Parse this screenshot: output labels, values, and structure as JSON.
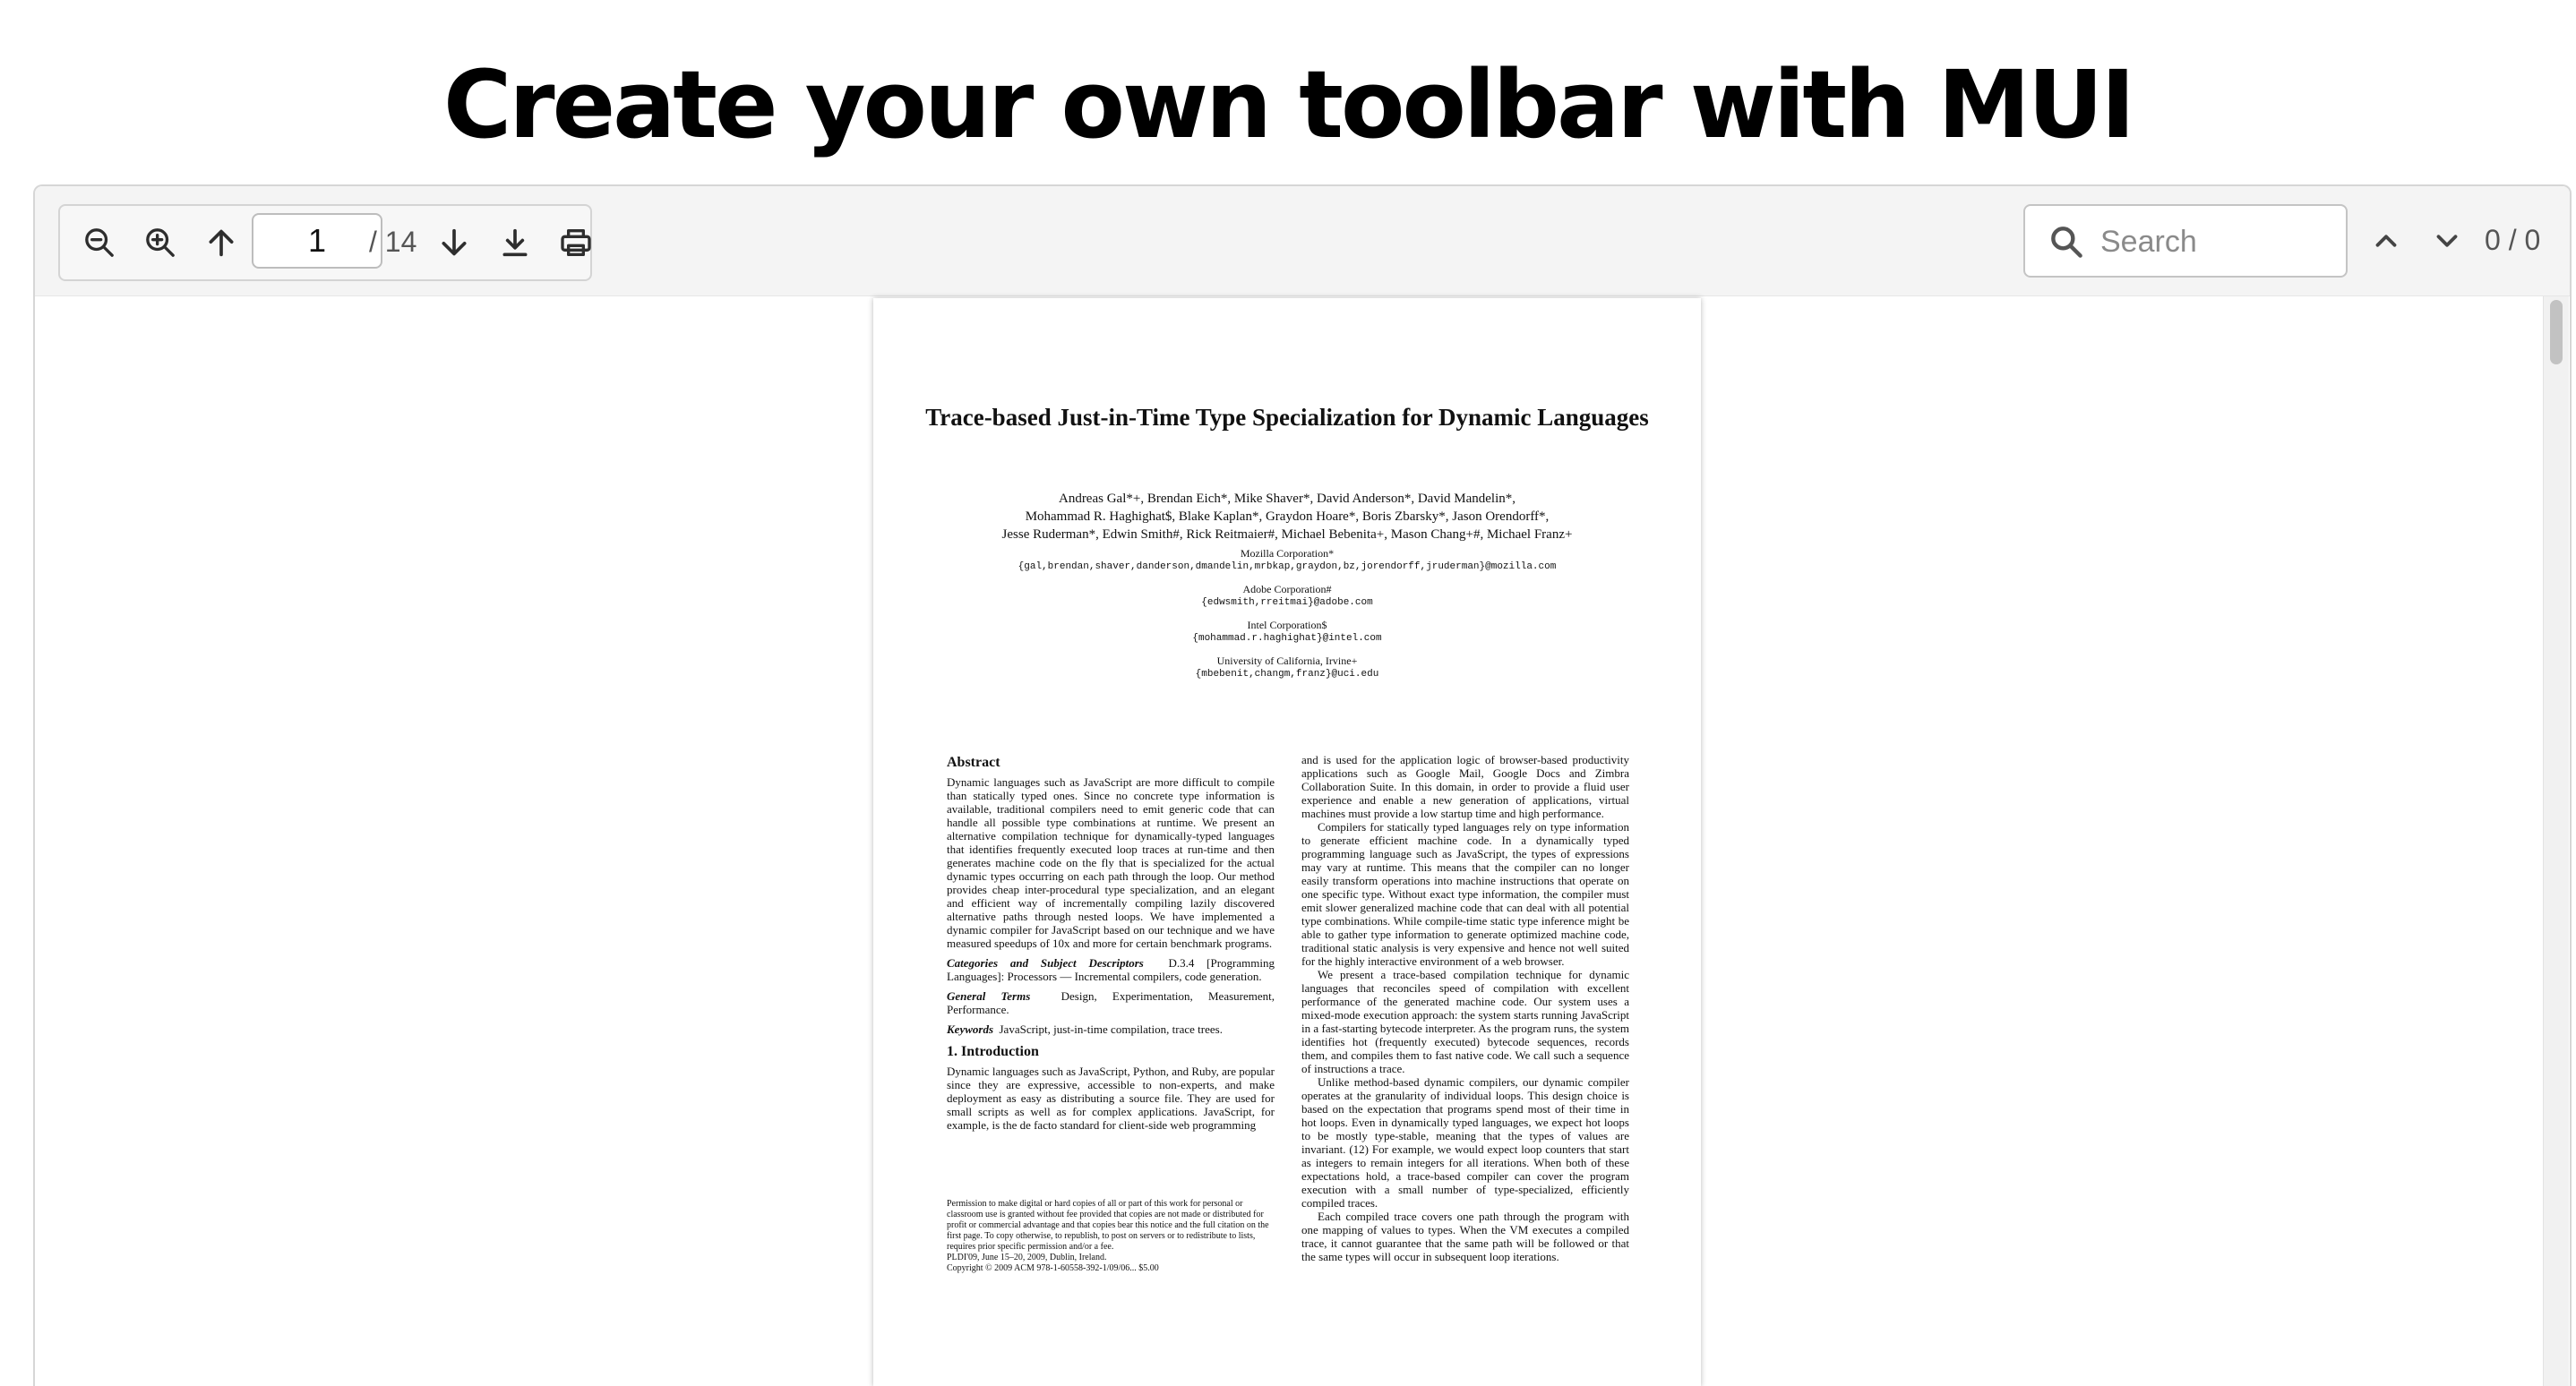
{
  "heading": "Create your own toolbar with MUI",
  "toolbar": {
    "current_page": "1",
    "total_pages": "/ 14",
    "icons": [
      "zoom-out-icon",
      "zoom-in-icon",
      "arrow-up-icon",
      "arrow-down-icon",
      "download-icon",
      "print-icon",
      "search-icon",
      "chevron-up-icon",
      "chevron-down-icon"
    ]
  },
  "search": {
    "placeholder": "Search",
    "value": "",
    "match_count": "0 / 0"
  },
  "document": {
    "title": "Trace-based Just-in-Time Type Specialization for Dynamic Languages",
    "authors": [
      "Andreas Gal*+, Brendan Eich*, Mike Shaver*, David Anderson*, David Mandelin*,",
      "Mohammad R. Haghighat$, Blake Kaplan*, Graydon Hoare*, Boris Zbarsky*, Jason Orendorff*,",
      "Jesse Ruderman*, Edwin Smith#, Rick Reitmaier#, Michael Bebenita+, Mason Chang+#, Michael Franz+"
    ],
    "affiliations": [
      {
        "name": "Mozilla Corporation*",
        "email": "{gal,brendan,shaver,danderson,dmandelin,mrbkap,graydon,bz,jorendorff,jruderman}@mozilla.com"
      },
      {
        "name": "Adobe Corporation#",
        "email": "{edwsmith,rreitmai}@adobe.com"
      },
      {
        "name": "Intel Corporation$",
        "email": "{mohammad.r.haghighat}@intel.com"
      },
      {
        "name": "University of California, Irvine+",
        "email": "{mbebenit,changm,franz}@uci.edu"
      }
    ],
    "abstract_heading": "Abstract",
    "abstract": "Dynamic languages such as JavaScript are more difficult to compile than statically typed ones. Since no concrete type information is available, traditional compilers need to emit generic code that can handle all possible type combinations at runtime. We present an alternative compilation technique for dynamically-typed languages that identifies frequently executed loop traces at run-time and then generates machine code on the fly that is specialized for the actual dynamic types occurring on each path through the loop. Our method provides cheap inter-procedural type specialization, and an elegant and efficient way of incrementally compiling lazily discovered alternative paths through nested loops. We have implemented a dynamic compiler for JavaScript based on our technique and we have measured speedups of 10x and more for certain benchmark programs.",
    "categories_label": "Categories and Subject Descriptors",
    "categories": "D.3.4 [Programming Languages]: Processors — Incremental compilers, code generation.",
    "general_label": "General Terms",
    "general": "Design, Experimentation, Measurement, Performance.",
    "keywords_label": "Keywords",
    "keywords": "JavaScript, just-in-time compilation, trace trees.",
    "intro_heading": "1.   Introduction",
    "intro": "Dynamic languages such as JavaScript, Python, and Ruby, are popular since they are expressive, accessible to non-experts, and make deployment as easy as distributing a source file. They are used for small scripts as well as for complex applications. JavaScript, for example, is the de facto standard for client-side web programming",
    "footnote": "Permission to make digital or hard copies of all or part of this work for personal or classroom use is granted without fee provided that copies are not made or distributed for profit or commercial advantage and that copies bear this notice and the full citation on the first page. To copy otherwise, to republish, to post on servers or to redistribute to lists, requires prior specific permission and/or a fee.",
    "conference": "PLDI'09,   June 15–20, 2009, Dublin, Ireland.",
    "copyright": "Copyright © 2009 ACM 978-1-60558-392-1/09/06... $5.00",
    "right_paragraphs": [
      "and is used for the application logic of browser-based productivity applications such as Google Mail, Google Docs and Zimbra Collaboration Suite. In this domain, in order to provide a fluid user experience and enable a new generation of applications, virtual machines must provide a low startup time and high performance.",
      "Compilers for statically typed languages rely on type information to generate efficient machine code. In a dynamically typed programming language such as JavaScript, the types of expressions may vary at runtime. This means that the compiler can no longer easily transform operations into machine instructions that operate on one specific type. Without exact type information, the compiler must emit slower generalized machine code that can deal with all potential type combinations. While compile-time static type inference might be able to gather type information to generate optimized machine code, traditional static analysis is very expensive and hence not well suited for the highly interactive environment of a web browser.",
      "We present a trace-based compilation technique for dynamic languages that reconciles speed of compilation with excellent performance of the generated machine code. Our system uses a mixed-mode execution approach: the system starts running JavaScript in a fast-starting bytecode interpreter. As the program runs, the system identifies hot (frequently executed) bytecode sequences, records them, and compiles them to fast native code. We call such a sequence of instructions a trace.",
      "Unlike method-based dynamic compilers, our dynamic compiler operates at the granularity of individual loops. This design choice is based on the expectation that programs spend most of their time in hot loops. Even in dynamically typed languages, we expect hot loops to be mostly type-stable, meaning that the types of values are invariant. (12) For example, we would expect loop counters that start as integers to remain integers for all iterations. When both of these expectations hold, a trace-based compiler can cover the program execution with a small number of type-specialized, efficiently compiled traces.",
      "Each compiled trace covers one path through the program with one mapping of values to types. When the VM executes a compiled trace, it cannot guarantee that the same path will be followed or that the same types will occur in subsequent loop iterations."
    ]
  }
}
